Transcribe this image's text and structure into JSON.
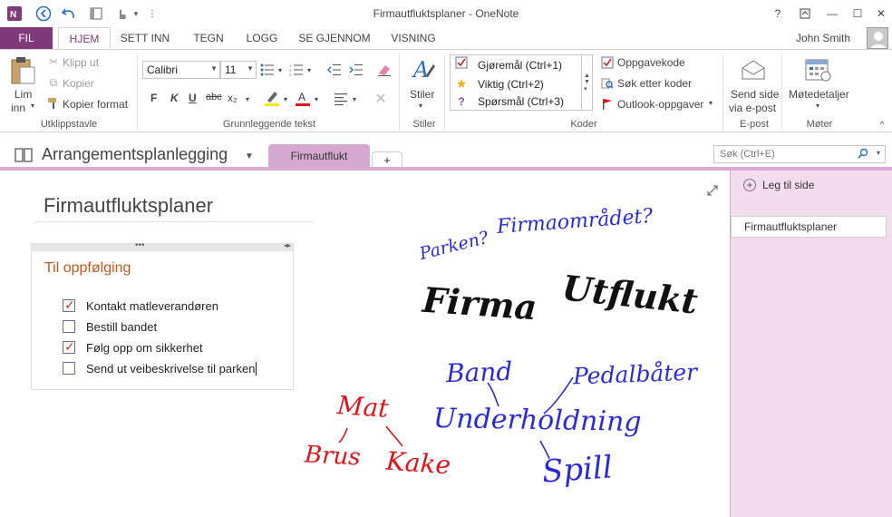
{
  "window": {
    "title": "Firmautfluktsplaner - OneNote",
    "controls": {
      "help": "?",
      "restore": "⧉",
      "minimize": "—",
      "maximize": "☐",
      "close": "✕"
    }
  },
  "quick_access": {
    "icons": [
      "onenote-logo-icon",
      "back-icon",
      "undo-icon",
      "dock-icon",
      "touch-mode-icon",
      "customize-icon"
    ]
  },
  "tabs": [
    "FIL",
    "HJEM",
    "SETT INN",
    "TEGN",
    "LOGG",
    "SE GJENNOM",
    "VISNING"
  ],
  "active_tab": "HJEM",
  "user": {
    "name": "John Smith"
  },
  "ribbon": {
    "clipboard": {
      "paste_label": "Lim",
      "paste_label2": "inn",
      "cut": "Klipp ut",
      "copy": "Kopier",
      "format_painter": "Kopier format",
      "group_label": "Utklippstavle"
    },
    "basic_text": {
      "font": "Calibri",
      "size": "11",
      "bold": "F",
      "italic": "K",
      "underline": "U",
      "strike": "abc",
      "subscript": "x₂",
      "group_label": "Grunnleggende tekst"
    },
    "styles": {
      "label": "Stiler",
      "group_label": "Stiler"
    },
    "tags": {
      "items": [
        {
          "label": "Gjøremål (Ctrl+1)",
          "icon": "checkbox-icon"
        },
        {
          "label": "Viktig (Ctrl+2)",
          "icon": "star-icon"
        },
        {
          "label": "Spørsmål (Ctrl+3)",
          "icon": "question-icon"
        }
      ],
      "todo_tag": "Oppgavekode",
      "find_tags": "Søk etter koder",
      "outlook_tasks": "Outlook-oppgaver",
      "group_label": "Koder"
    },
    "email": {
      "label": "Send side",
      "label2": "via e-post",
      "group_label": "E-post"
    },
    "meetings": {
      "label": "Møtedetaljer",
      "group_label": "Møter"
    }
  },
  "notebook": {
    "name": "Arrangementsplanlegging",
    "section": "Firmautflukt",
    "add_section": "+",
    "search_placeholder": "Søk (Ctrl+E)"
  },
  "page": {
    "title": "Firmautfluktsplaner",
    "note": {
      "heading": "Til oppfølging",
      "items": [
        {
          "text": "Kontakt matleverandøren",
          "checked": true
        },
        {
          "text": "Bestill bandet",
          "checked": false
        },
        {
          "text": "Følg opp om sikkerhet",
          "checked": true
        },
        {
          "text": "Send ut veibeskrivelse til parken",
          "checked": false
        }
      ]
    },
    "ink": {
      "firmaomradet": "Firmaområdet?",
      "parken": "Parken?",
      "firma": "Firma",
      "utflukt": "Utflukt",
      "band": "Band",
      "pedalbater": "Pedalbåter",
      "underholdning": "Underholdning",
      "spill": "Spill",
      "mat": "Mat",
      "brus": "Brus",
      "kake": "Kake"
    }
  },
  "page_pane": {
    "add_page": "Leg til side",
    "pages": [
      "Firmautfluktsplaner"
    ]
  },
  "colors": {
    "accent": "#80397b",
    "section_tab": "#d4a8cf",
    "pane_bg": "#f2dcee",
    "ink_blue": "#2b2bd6",
    "ink_red": "#e0141c",
    "heading_orange": "#c05a1a"
  }
}
